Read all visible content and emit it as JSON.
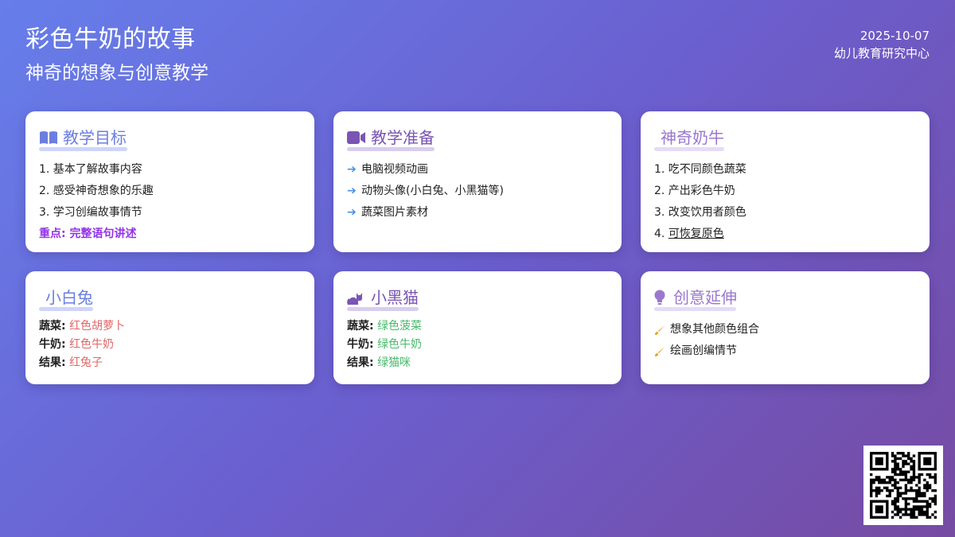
{
  "header": {
    "title": "彩色牛奶的故事",
    "subtitle": "神奇的想象与创意教学",
    "date": "2025-10-07",
    "org": "幼儿教育研究中心"
  },
  "cards": {
    "goals": {
      "title": "教学目标",
      "icon": "book-icon",
      "items": [
        "1. 基本了解故事内容",
        "2. 感受神奇想象的乐趣",
        "3. 学习创编故事情节"
      ],
      "emphasis_label": "重点:",
      "emphasis_value": "完整语句讲述"
    },
    "prep": {
      "title": "教学准备",
      "icon": "video-camera-icon",
      "items": [
        "电脑视频动画",
        "动物头像(小白兔、小黑猫等)",
        "蔬菜图片素材"
      ]
    },
    "cow": {
      "title": "神奇奶牛",
      "items": [
        "1. 吃不同颜色蔬菜",
        "2. 产出彩色牛奶",
        "3. 改变饮用者颜色"
      ],
      "last_prefix": "4. ",
      "last_text": "可恢复原色"
    },
    "rabbit": {
      "title": "小白兔",
      "veg_label": "蔬菜:",
      "veg": "红色胡萝卜",
      "milk_label": "牛奶:",
      "milk": "红色牛奶",
      "result_label": "结果:",
      "result": "红兔子"
    },
    "cat": {
      "title": "小黑猫",
      "icon": "cat-icon",
      "veg_label": "蔬菜:",
      "veg": "绿色菠菜",
      "milk_label": "牛奶:",
      "milk": "绿色牛奶",
      "result_label": "结果:",
      "result": "绿猫咪"
    },
    "extend": {
      "title": "创意延伸",
      "icon": "lightbulb-icon",
      "items": [
        "想象其他颜色组合",
        "绘画创编情节"
      ]
    }
  },
  "colors": {
    "bg_start": "#667eea",
    "bg_end": "#764ba2",
    "emphasis": "#9333ea",
    "red": "#e06666",
    "green": "#48b86c",
    "arrow": "#4a90e2"
  }
}
